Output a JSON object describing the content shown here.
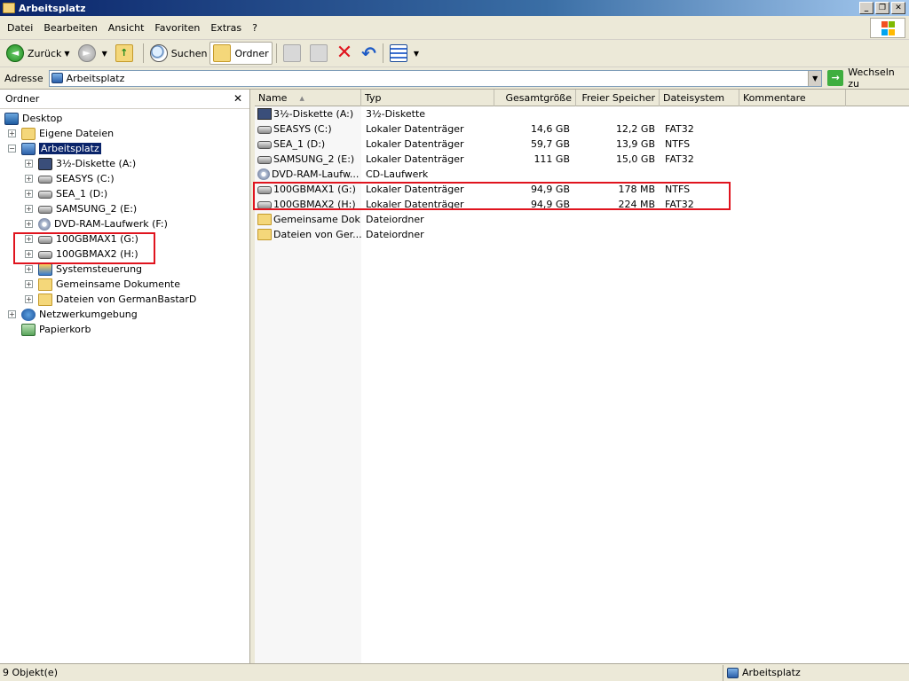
{
  "window": {
    "title": "Arbeitsplatz"
  },
  "menu": {
    "items": [
      "Datei",
      "Bearbeiten",
      "Ansicht",
      "Favoriten",
      "Extras",
      "?"
    ]
  },
  "toolbar": {
    "back_label": "Zurück",
    "search_label": "Suchen",
    "folders_label": "Ordner"
  },
  "address": {
    "label": "Adresse",
    "value": "Arbeitsplatz",
    "go_label": "Wechseln zu"
  },
  "sidebar": {
    "title": "Ordner",
    "close_glyph": "✕",
    "items": [
      {
        "label": "Desktop",
        "icon": "desktop-icon"
      },
      {
        "label": "Eigene Dateien",
        "icon": "my-documents-icon"
      },
      {
        "label": "Arbeitsplatz",
        "icon": "my-computer-icon",
        "selected": true
      },
      {
        "label": "3½-Diskette (A:)",
        "icon": "floppy-drive-icon"
      },
      {
        "label": "SEASYS (C:)",
        "icon": "hard-drive-icon"
      },
      {
        "label": "SEA_1 (D:)",
        "icon": "hard-drive-icon"
      },
      {
        "label": "SAMSUNG_2 (E:)",
        "icon": "hard-drive-icon"
      },
      {
        "label": "DVD-RAM-Laufwerk (F:)",
        "icon": "cd-drive-icon"
      },
      {
        "label": "100GBMAX1 (G:)",
        "icon": "hard-drive-icon"
      },
      {
        "label": "100GBMAX2 (H:)",
        "icon": "hard-drive-icon"
      },
      {
        "label": "Systemsteuerung",
        "icon": "control-panel-icon"
      },
      {
        "label": "Gemeinsame Dokumente",
        "icon": "folder-icon"
      },
      {
        "label": "Dateien von GermanBastarD",
        "icon": "folder-icon"
      },
      {
        "label": "Netzwerkumgebung",
        "icon": "network-icon"
      },
      {
        "label": "Papierkorb",
        "icon": "recycle-bin-icon"
      }
    ]
  },
  "list": {
    "columns": [
      "Name",
      "Typ",
      "Gesamtgröße",
      "Freier Speicher",
      "Dateisystem",
      "Kommentare"
    ],
    "sort_glyph": "▲",
    "rows": [
      {
        "name": "3½-Diskette (A:)",
        "type": "3½-Diskette",
        "size": "",
        "free": "",
        "fs": "",
        "icon": "floppy-drive-icon"
      },
      {
        "name": "SEASYS (C:)",
        "type": "Lokaler Datenträger",
        "size": "14,6 GB",
        "free": "12,2 GB",
        "fs": "FAT32",
        "icon": "hard-drive-icon"
      },
      {
        "name": "SEA_1 (D:)",
        "type": "Lokaler Datenträger",
        "size": "59,7 GB",
        "free": "13,9 GB",
        "fs": "NTFS",
        "icon": "hard-drive-icon"
      },
      {
        "name": "SAMSUNG_2 (E:)",
        "type": "Lokaler Datenträger",
        "size": "111 GB",
        "free": "15,0 GB",
        "fs": "FAT32",
        "icon": "hard-drive-icon"
      },
      {
        "name": "DVD-RAM-Laufw...",
        "type": "CD-Laufwerk",
        "size": "",
        "free": "",
        "fs": "",
        "icon": "cd-drive-icon"
      },
      {
        "name": "100GBMAX1 (G:)",
        "type": "Lokaler Datenträger",
        "size": "94,9 GB",
        "free": "178 MB",
        "fs": "NTFS",
        "icon": "hard-drive-icon"
      },
      {
        "name": "100GBMAX2 (H:)",
        "type": "Lokaler Datenträger",
        "size": "94,9 GB",
        "free": "224 MB",
        "fs": "FAT32",
        "icon": "hard-drive-icon"
      },
      {
        "name": "Gemeinsame Dok...",
        "type": "Dateiordner",
        "size": "",
        "free": "",
        "fs": "",
        "icon": "folder-icon"
      },
      {
        "name": "Dateien von Ger...",
        "type": "Dateiordner",
        "size": "",
        "free": "",
        "fs": "",
        "icon": "folder-icon"
      }
    ]
  },
  "status": {
    "left": "9 Objekt(e)",
    "right": "Arbeitsplatz"
  },
  "colors": {
    "selection": "#0a246a",
    "highlight": "#e0141e",
    "chrome": "#ece9d8"
  }
}
